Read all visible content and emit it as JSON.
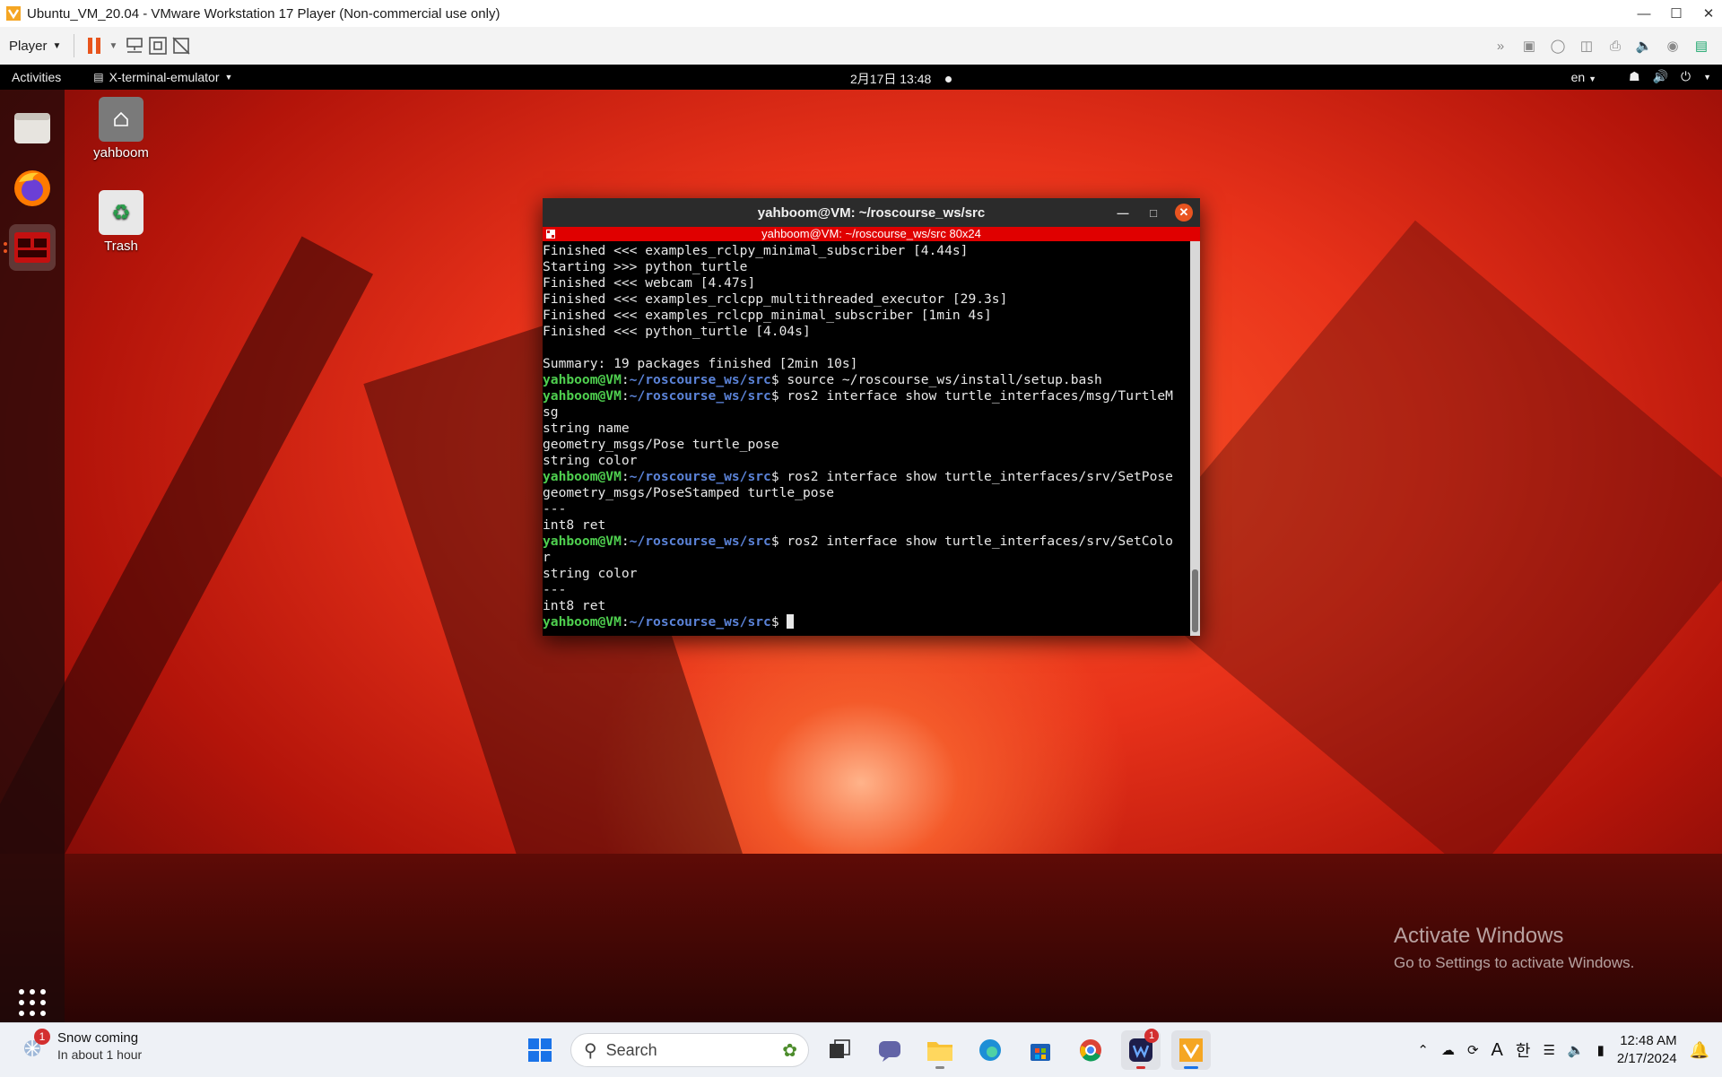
{
  "vmware": {
    "window_title": "Ubuntu_VM_20.04 - VMware Workstation 17 Player (Non-commercial use only)",
    "player_menu": "Player"
  },
  "ubuntu": {
    "activities": "Activities",
    "app_menu": "X-terminal-emulator",
    "clock": "2月17日  13:48",
    "keyboard": "en",
    "desktop_icons": {
      "home": "yahboom",
      "trash": "Trash"
    }
  },
  "terminal": {
    "title": "yahboom@VM: ~/roscourse_ws/src",
    "subtitle": "yahboom@VM: ~/roscourse_ws/src 80x24",
    "prompt_user": "yahboom@VM",
    "prompt_path": "~/roscourse_ws/src",
    "lines": {
      "l1": "Finished <<< examples_rclpy_minimal_subscriber [4.44s]",
      "l2": "Starting >>> python_turtle",
      "l3": "Finished <<< webcam [4.47s]",
      "l4": "Finished <<< examples_rclcpp_multithreaded_executor [29.3s]",
      "l5": "Finished <<< examples_rclcpp_minimal_subscriber [1min 4s]",
      "l6": "Finished <<< python_turtle [4.04s]",
      "l8": "Summary: 19 packages finished [2min 10s]",
      "c1": "$ source ~/roscourse_ws/install/setup.bash",
      "c2": "$ ros2 interface show turtle_interfaces/msg/TurtleM",
      "l11": "sg",
      "l12": "string name",
      "l13": "geometry_msgs/Pose turtle_pose",
      "l14": "string color",
      "c3": "$ ros2 interface show turtle_interfaces/srv/SetPose",
      "l16": "geometry_msgs/PoseStamped turtle_pose",
      "l17": "---",
      "l18": "int8 ret",
      "c4": "$ ros2 interface show turtle_interfaces/srv/SetColo",
      "l20": "r",
      "l21": "string color",
      "l22": "---",
      "l23": "int8 ret",
      "c5": "$ "
    }
  },
  "activation": {
    "title": "Activate Windows",
    "subtitle": "Go to Settings to activate Windows."
  },
  "taskbar": {
    "weather_title": "Snow coming",
    "weather_sub": "In about 1 hour",
    "weather_badge": "1",
    "search_placeholder": "Search",
    "app_badge": "1",
    "ime_label": "A",
    "lang_label": "한",
    "time": "12:48 AM",
    "date": "2/17/2024"
  },
  "colors": {
    "terminal_subtitle_bg": "#e00000",
    "prompt_user": "#4fd04f",
    "prompt_path": "#5b83d8",
    "ubuntu_orange": "#e95420"
  }
}
